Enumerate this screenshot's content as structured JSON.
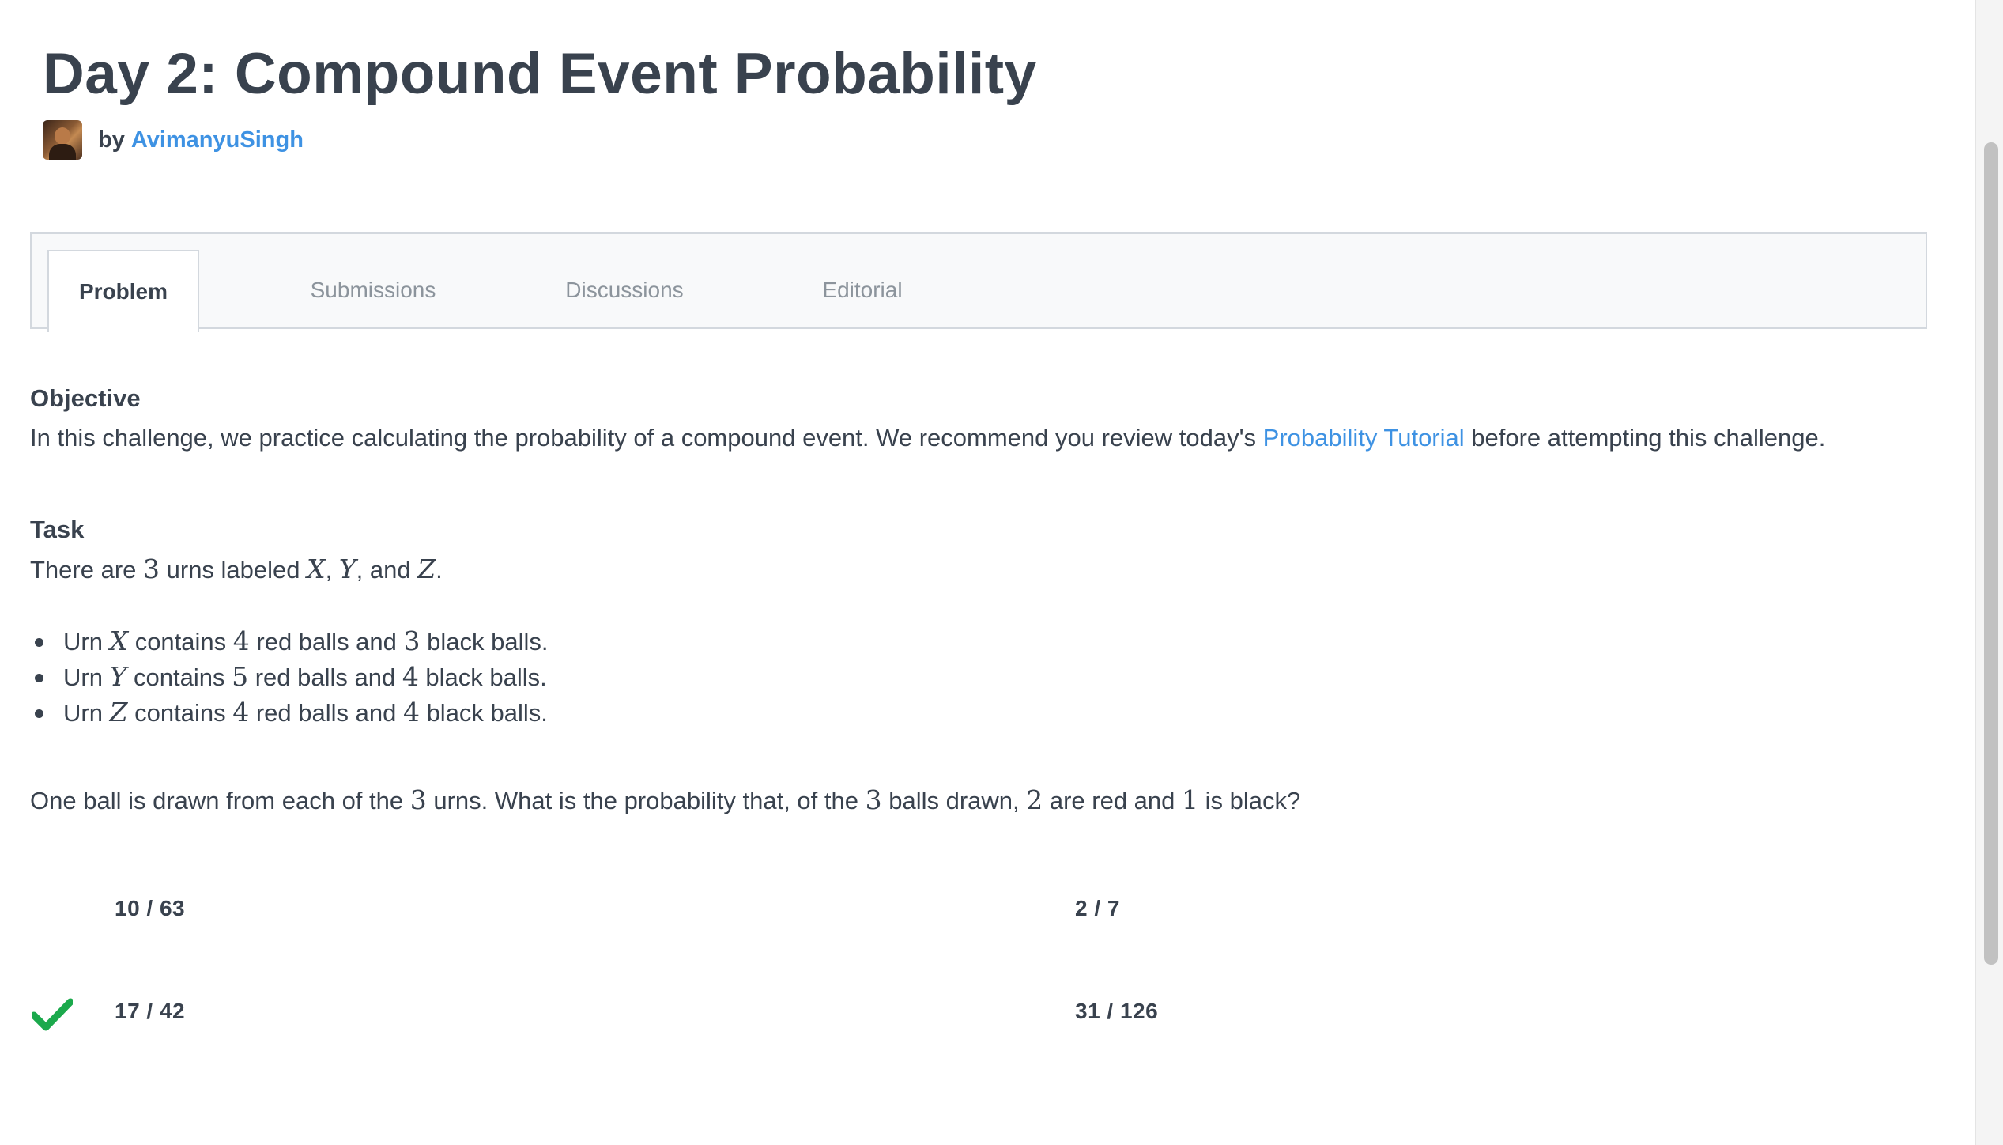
{
  "page": {
    "title": "Day 2: Compound Event Probability",
    "by_label": "by",
    "author": "AvimanyuSingh"
  },
  "tabs": [
    {
      "label": "Problem",
      "active": true
    },
    {
      "label": "Submissions",
      "active": false
    },
    {
      "label": "Discussions",
      "active": false
    },
    {
      "label": "Editorial",
      "active": false
    }
  ],
  "objective": {
    "heading": "Objective",
    "text_before": "In this challenge, we practice calculating the probability of a compound event. We recommend you review today's ",
    "link_text": "Probability Tutorial",
    "text_after": " before attempting this challenge."
  },
  "task": {
    "heading": "Task",
    "intro": {
      "p1": "There are ",
      "n": "3",
      "p2": " urns labeled ",
      "x": "X",
      "c1": ", ",
      "y": "Y",
      "c2": ", and ",
      "z": "Z",
      "end": "."
    },
    "urns": [
      {
        "urn": "Urn ",
        "name": "X",
        "contains": " contains ",
        "red": "4",
        "red_label": " red balls and ",
        "black": "3",
        "black_label": " black balls."
      },
      {
        "urn": "Urn ",
        "name": "Y",
        "contains": " contains ",
        "red": "5",
        "red_label": " red balls and ",
        "black": "4",
        "black_label": " black balls."
      },
      {
        "urn": "Urn ",
        "name": "Z",
        "contains": " contains ",
        "red": "4",
        "red_label": " red balls and ",
        "black": "4",
        "black_label": " black balls."
      }
    ],
    "question": {
      "p1": "One ball is drawn from each of the ",
      "n1": "3",
      "p2": " urns. What is the probability that, of the ",
      "n2": "3",
      "p3": " balls drawn, ",
      "n3": "2",
      "p4": " are red and ",
      "n4": "1",
      "p5": " is black?"
    }
  },
  "options": [
    {
      "label": "10 / 63",
      "selected": false
    },
    {
      "label": "2 / 7",
      "selected": false
    },
    {
      "label": "17 / 42",
      "selected": true
    },
    {
      "label": "31 / 126",
      "selected": false
    }
  ],
  "colors": {
    "text": "#39424e",
    "link": "#3e92e3",
    "muted_tab": "#8c949c",
    "check": "#1ba94c"
  },
  "icons": {
    "avatar": "user-avatar",
    "correct": "checkmark-icon"
  }
}
